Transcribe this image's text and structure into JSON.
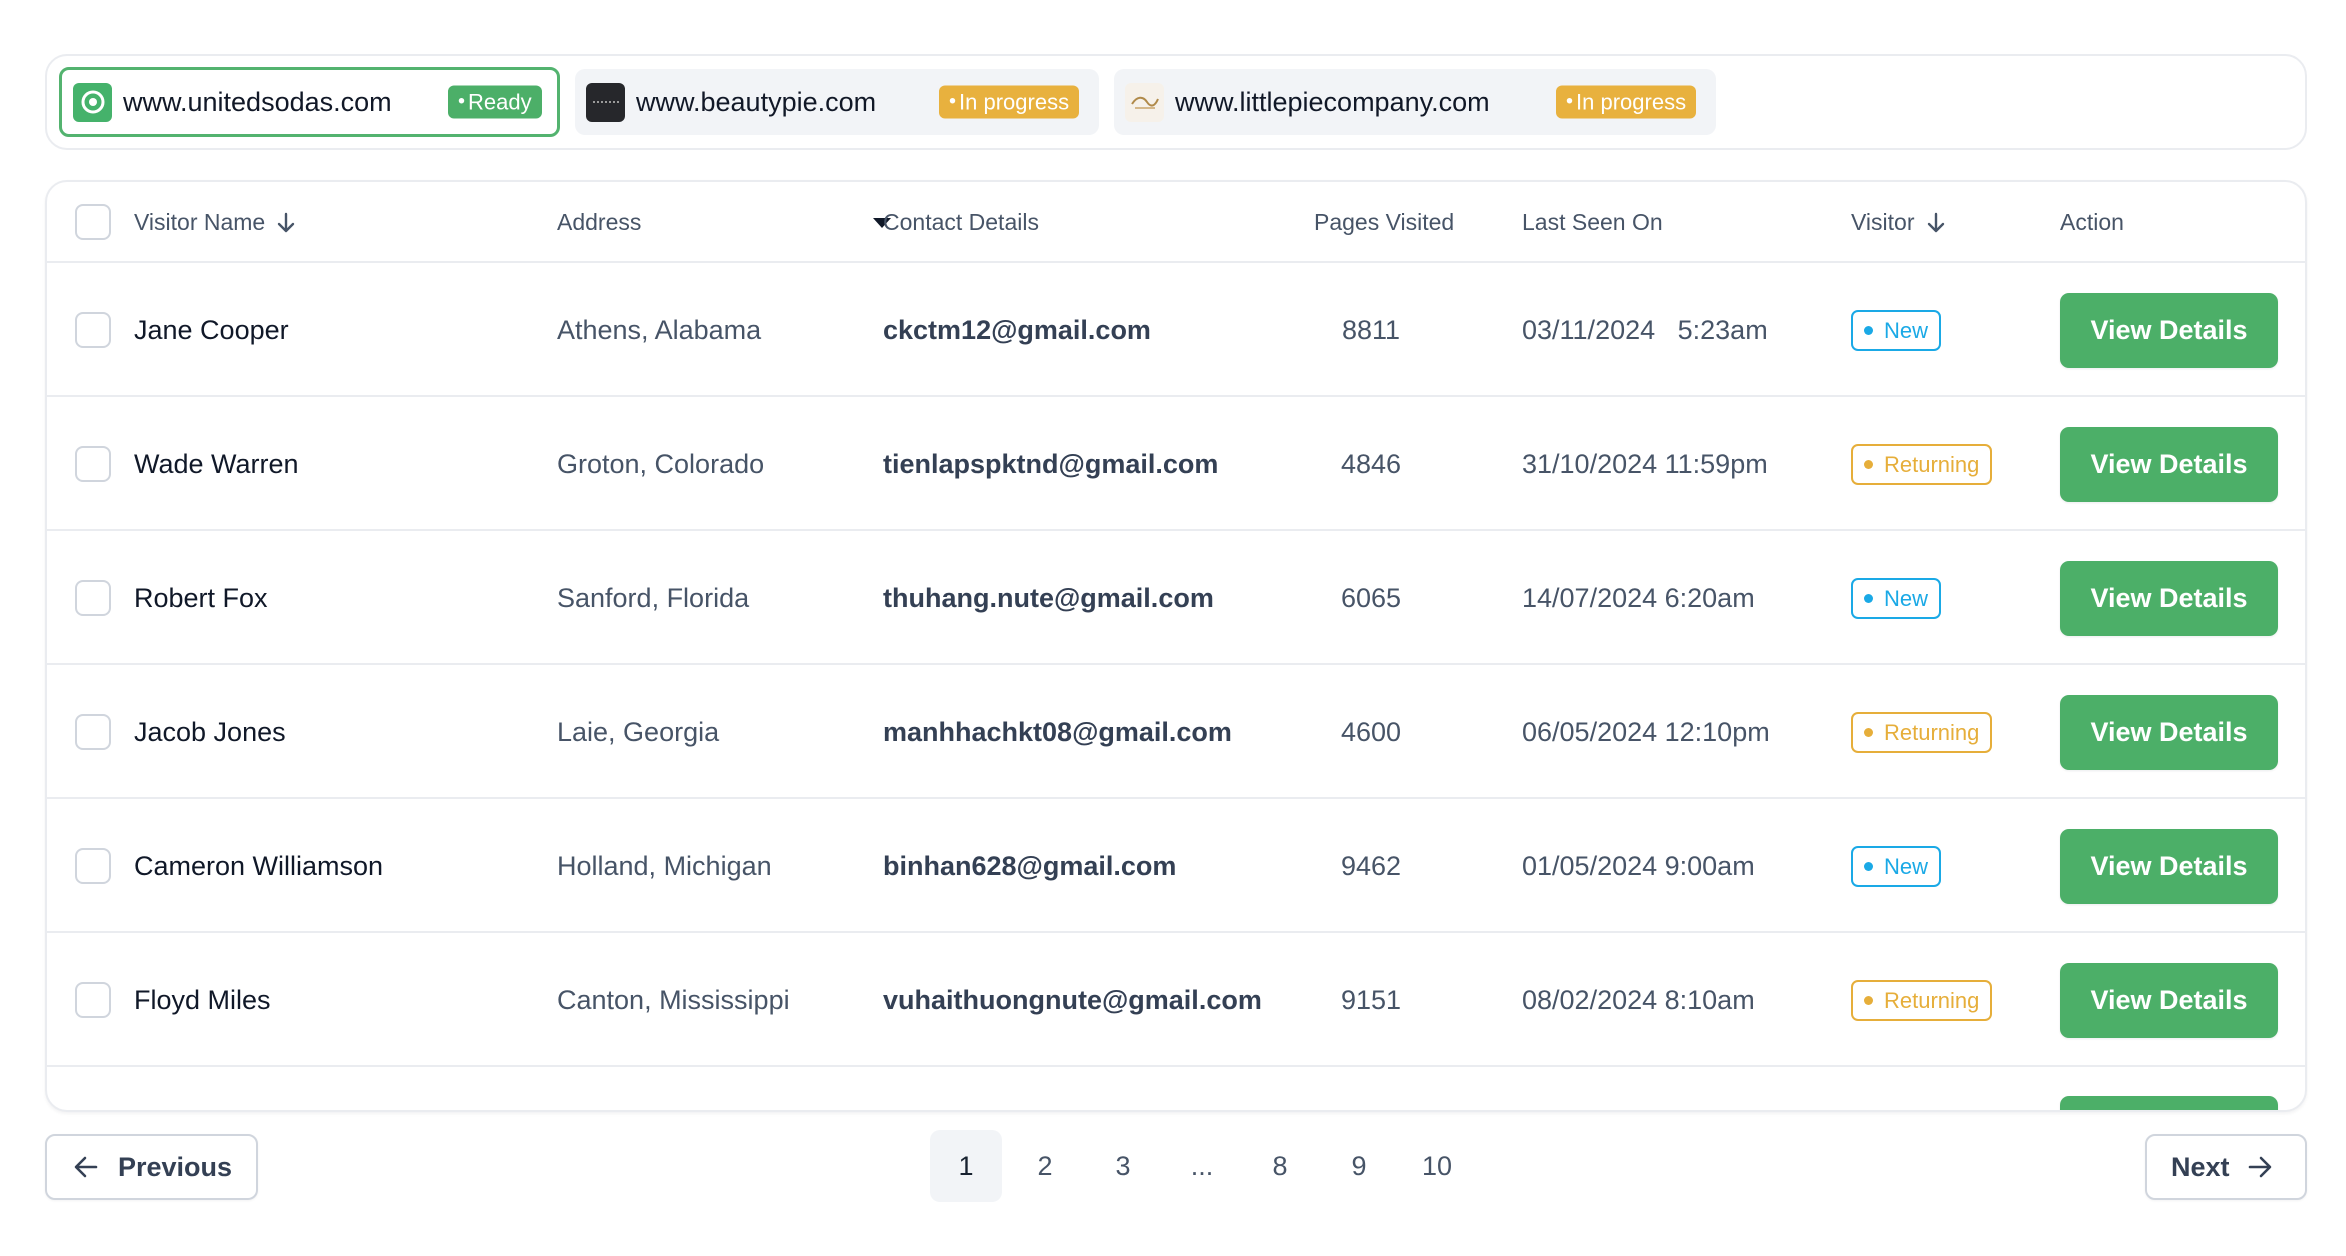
{
  "sites": [
    {
      "url": "www.unitedsodas.com",
      "status": "Ready",
      "favicon": "unitedsodas-logo-icon"
    },
    {
      "url": "www.beautypie.com",
      "status": "In progress",
      "favicon": "beautypie-logo-icon"
    },
    {
      "url": "www.littlepiecompany.com",
      "status": "In progress",
      "favicon": "littlepiecompany-logo-icon"
    }
  ],
  "table": {
    "headers": {
      "name": "Visitor Name",
      "address": "Address",
      "contact": "Contact Details",
      "pages": "Pages Visited",
      "last_seen": "Last Seen On",
      "visitor": "Visitor",
      "action": "Action"
    },
    "rows": [
      {
        "name": "Jane Cooper",
        "address": "Athens, Alabama",
        "email": "ckctm12@gmail.com",
        "pages": "8811",
        "last_seen": "03/11/2024   5:23am",
        "visitor": "New",
        "action": "View Details"
      },
      {
        "name": "Wade Warren",
        "address": "Groton, Colorado",
        "email": "tienlapspktnd@gmail.com",
        "pages": "4846",
        "last_seen": "31/10/2024 11:59pm",
        "visitor": "Returning",
        "action": "View Details"
      },
      {
        "name": "Robert Fox",
        "address": "Sanford, Florida",
        "email": "thuhang.nute@gmail.com",
        "pages": "6065",
        "last_seen": "14/07/2024 6:20am",
        "visitor": "New",
        "action": "View Details"
      },
      {
        "name": "Jacob Jones",
        "address": "Laie, Georgia",
        "email": "manhhachkt08@gmail.com",
        "pages": "4600",
        "last_seen": "06/05/2024 12:10pm",
        "visitor": "Returning",
        "action": "View Details"
      },
      {
        "name": "Cameron Williamson",
        "address": "Holland, Michigan",
        "email": "binhan628@gmail.com",
        "pages": "9462",
        "last_seen": "01/05/2024 9:00am",
        "visitor": "New",
        "action": "View Details"
      },
      {
        "name": "Floyd Miles",
        "address": "Canton, Mississippi",
        "email": "vuhaithuongnute@gmail.com",
        "pages": "9151",
        "last_seen": "08/02/2024 8:10am",
        "visitor": "Returning",
        "action": "View Details"
      }
    ]
  },
  "pagination": {
    "previous": "Previous",
    "next": "Next",
    "pages": [
      "1",
      "2",
      "3",
      "...",
      "8",
      "9",
      "10"
    ],
    "current": "1"
  },
  "colors": {
    "accent_green": "#4caf68",
    "progress_amber": "#e8b13e",
    "new_blue": "#1aa9e6",
    "returning_amber": "#e6ae3a"
  }
}
